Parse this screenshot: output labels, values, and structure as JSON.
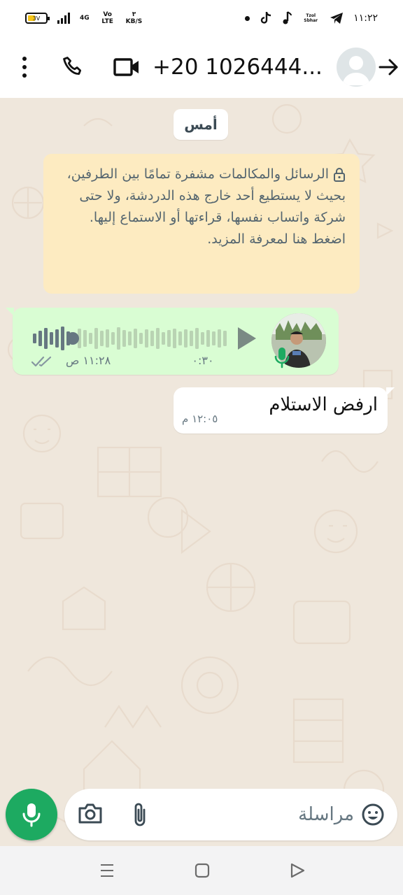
{
  "status_bar": {
    "battery": "3V",
    "network": "4G",
    "volte": "Vo LTE",
    "speed_value": "٣",
    "speed_unit": "KB/S",
    "tzfr_label": "Tzol Sbhar",
    "time": "١١:٢٢"
  },
  "header": {
    "contact_name": "+20 1026444...",
    "icons": [
      "more-vert-icon",
      "phone-icon",
      "video-call-icon",
      "back-arrow-icon"
    ]
  },
  "chat": {
    "date_chip": "أمس",
    "encryption_notice": "الرسائل والمكالمات مشفرة تمامًا بين الطرفين، بحيث لا يستطيع أحد خارج هذه الدردشة، ولا حتى شركة واتساب نفسها، قراءتها أو الاستماع إليها. اضغط هنا لمعرفة المزيد.",
    "voice_message": {
      "duration": "٠:٣٠",
      "time": "١١:٢٨ ص",
      "progress": 0.2,
      "status": "read"
    },
    "text_message": {
      "text": "ارفض الاستلام",
      "time": "١٢:٠٥ م"
    }
  },
  "input_bar": {
    "placeholder": "مراسلة",
    "icons": [
      "emoji-icon",
      "attach-icon",
      "camera-icon",
      "mic-icon"
    ]
  },
  "colors": {
    "accent_green": "#1daa61",
    "outgoing_bubble": "#d9fdd3",
    "notice_bg": "#fdebc1",
    "chat_bg": "#efe7dc"
  }
}
